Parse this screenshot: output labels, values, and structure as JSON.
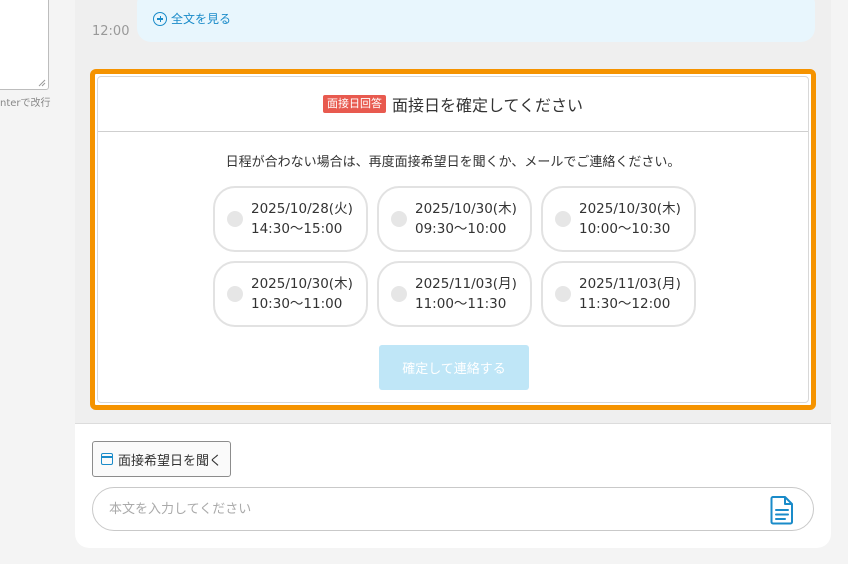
{
  "left": {
    "hint": "nterで改行"
  },
  "chat": {
    "time": "12:00",
    "read_more": "全文を見る"
  },
  "confirm": {
    "tag": "面接日回答",
    "title": "面接日を確定してください",
    "note": "日程が合わない場合は、再度面接希望日を聞くか、メールでご連絡ください。",
    "slots": [
      {
        "date": "2025/10/28(火)",
        "time": "14:30〜15:00"
      },
      {
        "date": "2025/10/30(木)",
        "time": "09:30〜10:00"
      },
      {
        "date": "2025/10/30(木)",
        "time": "10:00〜10:30"
      },
      {
        "date": "2025/10/30(木)",
        "time": "10:30〜11:00"
      },
      {
        "date": "2025/11/03(月)",
        "time": "11:00〜11:30"
      },
      {
        "date": "2025/11/03(月)",
        "time": "11:30〜12:00"
      }
    ],
    "button": "確定して連絡する"
  },
  "compose": {
    "ask_button": "面接希望日を聞く",
    "placeholder": "本文を入力してください"
  },
  "colors": {
    "highlight": "#f59300",
    "tag": "#e85a4f",
    "accent": "#1a8bc9",
    "button_disabled": "#bfe6f7"
  }
}
